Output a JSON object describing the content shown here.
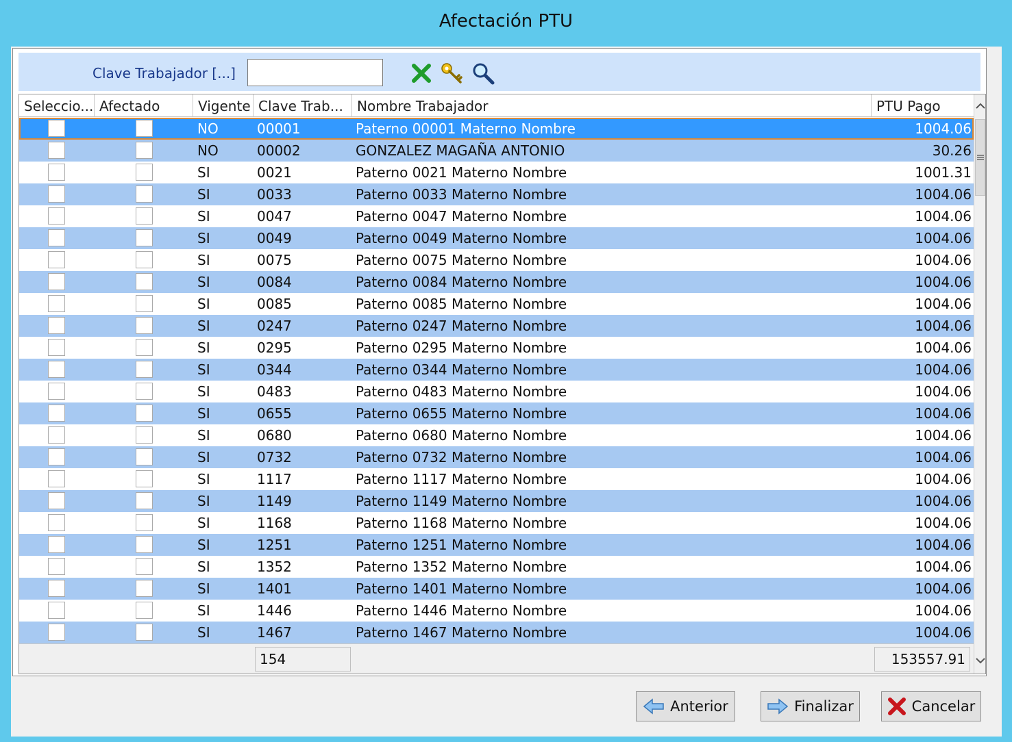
{
  "window": {
    "title": "Afectación PTU"
  },
  "toolbar": {
    "search_label": "Clave Trabajador  [...]",
    "search_value": "",
    "clear_icon": "green-x-icon",
    "key_icon": "key-icon",
    "find_icon": "magnifier-icon"
  },
  "grid": {
    "columns": [
      "Seleccio...",
      "Afectado",
      "Vigente",
      "Clave Trab...",
      "Nombre Trabajador",
      "PTU Pago"
    ],
    "rows": [
      {
        "vigente": "NO",
        "clave": "00001",
        "nombre": "Paterno 00001 Materno  Nombre",
        "ptu": "1004.06"
      },
      {
        "vigente": "NO",
        "clave": "00002",
        "nombre": "GONZALEZ MAGAÑA ANTONIO",
        "ptu": "30.26"
      },
      {
        "vigente": "SI",
        "clave": "0021",
        "nombre": "Paterno 0021 Materno  Nombre",
        "ptu": "1001.31"
      },
      {
        "vigente": "SI",
        "clave": "0033",
        "nombre": "Paterno 0033 Materno  Nombre",
        "ptu": "1004.06"
      },
      {
        "vigente": "SI",
        "clave": "0047",
        "nombre": "Paterno 0047 Materno  Nombre",
        "ptu": "1004.06"
      },
      {
        "vigente": "SI",
        "clave": "0049",
        "nombre": "Paterno 0049 Materno  Nombre",
        "ptu": "1004.06"
      },
      {
        "vigente": "SI",
        "clave": "0075",
        "nombre": "Paterno 0075 Materno  Nombre",
        "ptu": "1004.06"
      },
      {
        "vigente": "SI",
        "clave": "0084",
        "nombre": "Paterno 0084 Materno  Nombre",
        "ptu": "1004.06"
      },
      {
        "vigente": "SI",
        "clave": "0085",
        "nombre": "Paterno 0085 Materno  Nombre",
        "ptu": "1004.06"
      },
      {
        "vigente": "SI",
        "clave": "0247",
        "nombre": "Paterno 0247 Materno  Nombre",
        "ptu": "1004.06"
      },
      {
        "vigente": "SI",
        "clave": "0295",
        "nombre": "Paterno 0295 Materno  Nombre",
        "ptu": "1004.06"
      },
      {
        "vigente": "SI",
        "clave": "0344",
        "nombre": "Paterno 0344 Materno  Nombre",
        "ptu": "1004.06"
      },
      {
        "vigente": "SI",
        "clave": "0483",
        "nombre": "Paterno 0483 Materno  Nombre",
        "ptu": "1004.06"
      },
      {
        "vigente": "SI",
        "clave": "0655",
        "nombre": "Paterno 0655 Materno  Nombre",
        "ptu": "1004.06"
      },
      {
        "vigente": "SI",
        "clave": "0680",
        "nombre": "Paterno 0680 Materno  Nombre",
        "ptu": "1004.06"
      },
      {
        "vigente": "SI",
        "clave": "0732",
        "nombre": "Paterno 0732 Materno  Nombre",
        "ptu": "1004.06"
      },
      {
        "vigente": "SI",
        "clave": "1117",
        "nombre": "Paterno 1117 Materno  Nombre",
        "ptu": "1004.06"
      },
      {
        "vigente": "SI",
        "clave": "1149",
        "nombre": "Paterno 1149 Materno  Nombre",
        "ptu": "1004.06"
      },
      {
        "vigente": "SI",
        "clave": "1168",
        "nombre": "Paterno 1168 Materno  Nombre",
        "ptu": "1004.06"
      },
      {
        "vigente": "SI",
        "clave": "1251",
        "nombre": "Paterno 1251 Materno  Nombre",
        "ptu": "1004.06"
      },
      {
        "vigente": "SI",
        "clave": "1352",
        "nombre": "Paterno 1352 Materno  Nombre",
        "ptu": "1004.06"
      },
      {
        "vigente": "SI",
        "clave": "1401",
        "nombre": "Paterno 1401 Materno  Nombre",
        "ptu": "1004.06"
      },
      {
        "vigente": "SI",
        "clave": "1446",
        "nombre": "Paterno 1446 Materno  Nombre",
        "ptu": "1004.06"
      },
      {
        "vigente": "SI",
        "clave": "1467",
        "nombre": "Paterno 1467 Materno  Nombre",
        "ptu": "1004.06"
      }
    ],
    "footer": {
      "count": "154",
      "total": "153557.91"
    }
  },
  "buttons": {
    "anterior": "Anterior",
    "finalizar": "Finalizar",
    "cancelar": "Cancelar"
  },
  "colors": {
    "title_bar": "#5fc9ec",
    "toolbar_bg": "#cfe3fb",
    "row_alt": "#a7c9f2",
    "row_selected": "#3399ff"
  }
}
